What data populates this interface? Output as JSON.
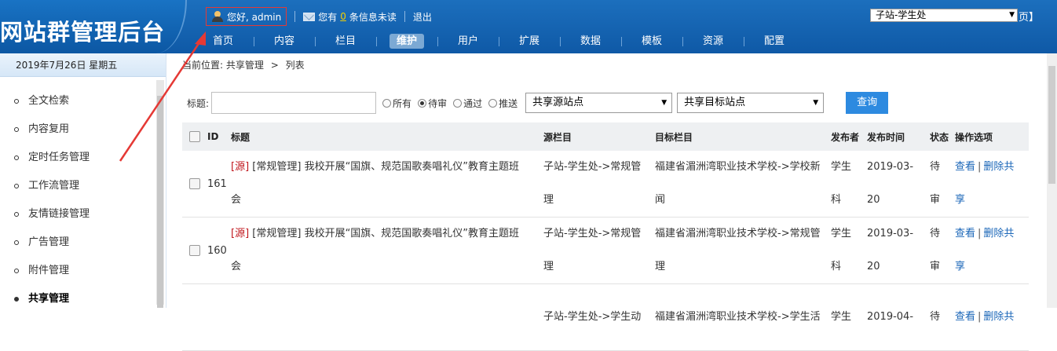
{
  "header": {
    "logo_text": "网站群管理后台",
    "greeting": "您好, admin",
    "msg_prefix": "您有",
    "msg_count": "0",
    "msg_suffix": "条信息未读",
    "logout": "退出",
    "site_select": "子站-学生处",
    "page_tail": "页】"
  },
  "nav": {
    "items": [
      "首页",
      "内容",
      "栏目",
      "维护",
      "用户",
      "扩展",
      "数据",
      "模板",
      "资源",
      "配置"
    ],
    "active": "维护"
  },
  "sidebar": {
    "date": "2019年7月26日 星期五",
    "items": [
      "全文检索",
      "内容复用",
      "定时任务管理",
      "工作流管理",
      "友情链接管理",
      "广告管理",
      "附件管理",
      "共享管理"
    ],
    "active": "共享管理"
  },
  "breadcrumb": {
    "label": "当前位置:",
    "path": [
      "共享管理",
      "列表"
    ],
    "separator": ">"
  },
  "filter": {
    "title_label": "标题:",
    "title_value": "",
    "radios": [
      "所有",
      "待审",
      "通过",
      "推送"
    ],
    "radio_selected": "待审",
    "source_site": "共享源站点",
    "target_site": "共享目标站点",
    "query_button": "查询"
  },
  "table": {
    "headers": {
      "id": "ID",
      "title": "标题",
      "source": "源栏目",
      "target": "目标栏目",
      "publisher": "发布者",
      "time": "发布时间",
      "state": "状态",
      "ops": "操作选项"
    },
    "rows": [
      {
        "id": "161",
        "tag": "[源]",
        "title_l1": "[常规管理] 我校开展“国旗、规范国歌奏唱礼仪”教育主题班",
        "title_l2": "会",
        "source_l1": "子站-学生处->常规管",
        "source_l2": "理",
        "target_l1": "福建省湄洲湾职业技术学校->学校新",
        "target_l2": "闻",
        "pub_l1": "学生",
        "pub_l2": "科",
        "time_l1": "2019-03-",
        "time_l2": "20",
        "state_l1": "待",
        "state_l2": "审",
        "op_view": "查看",
        "op_del_l1": "删除共",
        "op_del_l2": "享"
      },
      {
        "id": "160",
        "tag": "[源]",
        "title_l1": "[常规管理] 我校开展“国旗、规范国歌奏唱礼仪”教育主题班",
        "title_l2": "会",
        "source_l1": "子站-学生处->常规管",
        "source_l2": "理",
        "target_l1": "福建省湄洲湾职业技术学校->常规管",
        "target_l2": "理",
        "pub_l1": "学生",
        "pub_l2": "科",
        "time_l1": "2019-03-",
        "time_l2": "20",
        "state_l1": "待",
        "state_l2": "审",
        "op_view": "查看",
        "op_del_l1": "删除共",
        "op_del_l2": "享"
      },
      {
        "id": "",
        "tag": "",
        "title_l1": "",
        "title_l2": "",
        "source_l1": "子站-学生处->学生动",
        "source_l2": "",
        "target_l1": "福建省湄洲湾职业技术学校->学生活",
        "target_l2": "",
        "pub_l1": "学生",
        "pub_l2": "",
        "time_l1": "2019-04-",
        "time_l2": "",
        "state_l1": "待",
        "state_l2": "",
        "op_view": "查看",
        "op_del_l1": "删除共",
        "op_del_l2": ""
      }
    ]
  },
  "colors": {
    "header_blue": "#1565b3",
    "annotation_red": "#e53935",
    "link_blue": "#1a66b8",
    "query_button": "#2d8ae0"
  }
}
